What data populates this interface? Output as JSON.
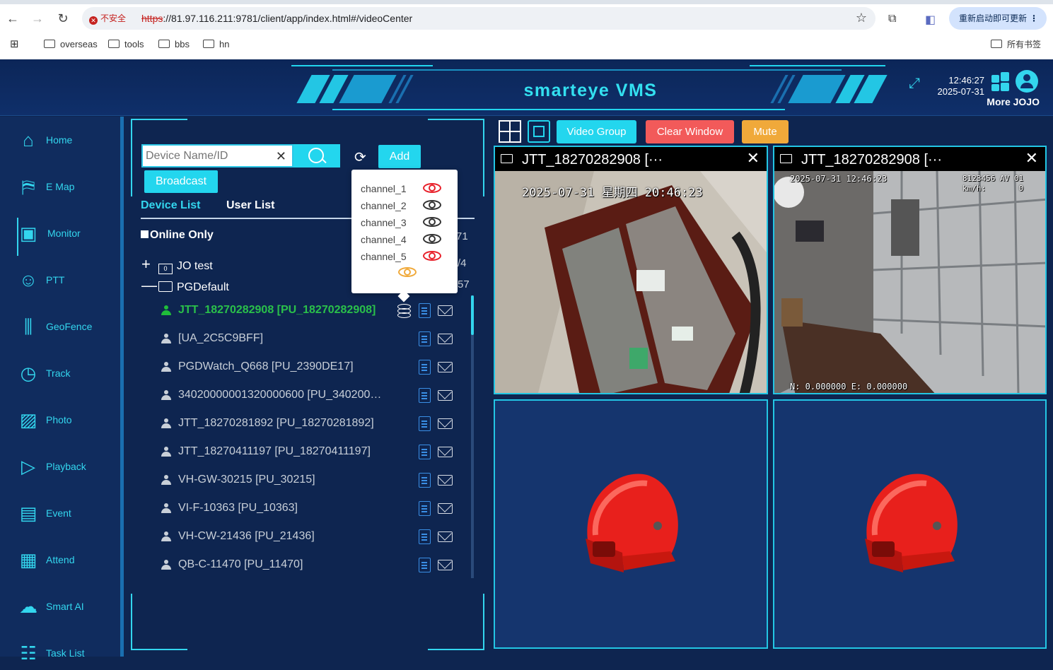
{
  "browser": {
    "insecure_label": "不安全",
    "url_scheme": "https",
    "url_rest": "://81.97.116.211:9781/client/app/index.html#/videoCenter",
    "update_label": "重新启动即可更新",
    "bookmarks": [
      "overseas",
      "tools",
      "bbs",
      "hn"
    ],
    "all_bookmarks": "所有书签"
  },
  "header": {
    "title": "smarteye VMS",
    "time": "12:46:27",
    "date": "2025-07-31",
    "more_user": "More JOJO"
  },
  "sidebar": {
    "items": [
      {
        "label": "Home",
        "icon": "home-icon"
      },
      {
        "label": "E Map",
        "icon": "map-icon"
      },
      {
        "label": "Monitor",
        "icon": "monitor-icon"
      },
      {
        "label": "PTT",
        "icon": "ptt-icon"
      },
      {
        "label": "GeoFence",
        "icon": "geofence-icon"
      },
      {
        "label": "Track",
        "icon": "track-icon"
      },
      {
        "label": "Photo",
        "icon": "photo-icon"
      },
      {
        "label": "Playback",
        "icon": "playback-icon"
      },
      {
        "label": "Event",
        "icon": "event-icon"
      },
      {
        "label": "Attend",
        "icon": "attend-icon"
      },
      {
        "label": "Smart AI",
        "icon": "smart-ai-icon"
      },
      {
        "label": "Task List",
        "icon": "task-list-icon"
      }
    ],
    "active": "Monitor"
  },
  "devices": {
    "search_placeholder": "Device Name/ID",
    "add_label": "Add",
    "broadcast_label": "Broadcast",
    "tab_device_list": "Device List",
    "tab_user_list": "User List",
    "online_only": "Online Only",
    "online_count_partial": "71",
    "groups": [
      {
        "sign": "+",
        "name": "JO test",
        "count_partial": "/4",
        "folder_badge": "0"
      },
      {
        "sign": "—",
        "name": "PGDefault",
        "count_partial": "57"
      }
    ],
    "rows": [
      {
        "name": "JTT_18270282908 [PU_18270282908]",
        "online": true
      },
      {
        "name": "[UA_2C5C9BFF]",
        "online": false
      },
      {
        "name": "PGDWatch_Q668 [PU_2390DE17]",
        "online": false
      },
      {
        "name": "34020000001320000600 [PU_340200…",
        "online": false
      },
      {
        "name": "JTT_18270281892 [PU_18270281892]",
        "online": false
      },
      {
        "name": "JTT_18270411197 [PU_18270411197]",
        "online": false
      },
      {
        "name": "VH-GW-30215 [PU_30215]",
        "online": false
      },
      {
        "name": "VI-F-10363 [PU_10363]",
        "online": false
      },
      {
        "name": "VH-CW-21436 [PU_21436]",
        "online": false
      },
      {
        "name": "QB-C-11470 [PU_11470]",
        "online": false
      }
    ]
  },
  "channels_popup": {
    "channels": [
      {
        "label": "channel_1",
        "state": "red"
      },
      {
        "label": "channel_2",
        "state": "black"
      },
      {
        "label": "channel_3",
        "state": "black"
      },
      {
        "label": "channel_4",
        "state": "black"
      },
      {
        "label": "channel_5",
        "state": "red"
      }
    ]
  },
  "video": {
    "video_group_label": "Video Group",
    "clear_window_label": "Clear Window",
    "mute_label": "Mute",
    "colors": {
      "cyan": "#23d6ee",
      "clear": "#f25a5a",
      "mute": "#f0a93a"
    },
    "cells": [
      {
        "title": "JTT_18270282908 [···",
        "osd": "2025-07-31 星期四 20:46:23"
      },
      {
        "title": "JTT_18270282908 [···",
        "osd_tl": "2025-07-31 12:46:23",
        "osd_tr1": "8123456 AV 01",
        "osd_tr2": "km/h:       0",
        "osd_bottom": "N: 0.000000 E: 0.000000"
      }
    ]
  }
}
